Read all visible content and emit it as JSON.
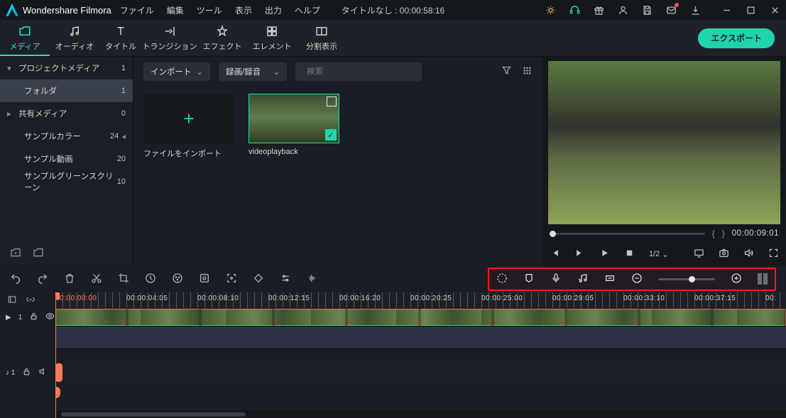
{
  "titlebar": {
    "app_name": "Wondershare Filmora",
    "menus": [
      "ファイル",
      "編集",
      "ツール",
      "表示",
      "出力",
      "ヘルプ"
    ],
    "doc_title": "タイトルなし : 00:00:58:16"
  },
  "tabs": [
    {
      "label": "メディア",
      "active": true
    },
    {
      "label": "オーディオ"
    },
    {
      "label": "タイトル"
    },
    {
      "label": "トランジション"
    },
    {
      "label": "エフェクト"
    },
    {
      "label": "エレメント"
    },
    {
      "label": "分割表示"
    }
  ],
  "export_label": "エクスポート",
  "sidebar": {
    "items": [
      {
        "label": "プロジェクトメディア",
        "count": "1",
        "chev": "▾"
      },
      {
        "label": "フォルダ",
        "count": "1",
        "child": true,
        "sel": true
      },
      {
        "label": "共有メディア",
        "count": "0",
        "chev": "▸"
      },
      {
        "label": "サンプルカラー",
        "count": "24",
        "chev": "▸",
        "suffix": "◂"
      },
      {
        "label": "サンプル動画",
        "count": "20"
      },
      {
        "label": "サンプルグリーンスクリーン",
        "count": "10"
      }
    ]
  },
  "media_panel": {
    "import_dd": "インポート",
    "record_dd": "録画/録音",
    "search_placeholder": "検索",
    "import_card_label": "ファイルをインポート",
    "clip_name": "videoplayback"
  },
  "preview": {
    "brace_l": "{",
    "brace_r": "}",
    "timecode": "00:00:09:01",
    "speed": "1/2"
  },
  "ruler": {
    "tcs": [
      "00:00:00:00",
      "00:00:04:05",
      "00:00:08:10",
      "00:00:12:15",
      "00:00:16:20",
      "00:00:20:25",
      "00:00:25:00",
      "00:00:29:05",
      "00:00:33:10",
      "00:00:37:15",
      "00:"
    ]
  },
  "gutter": {
    "vid_track": "1",
    "aud_track_label": "♪ 1"
  }
}
